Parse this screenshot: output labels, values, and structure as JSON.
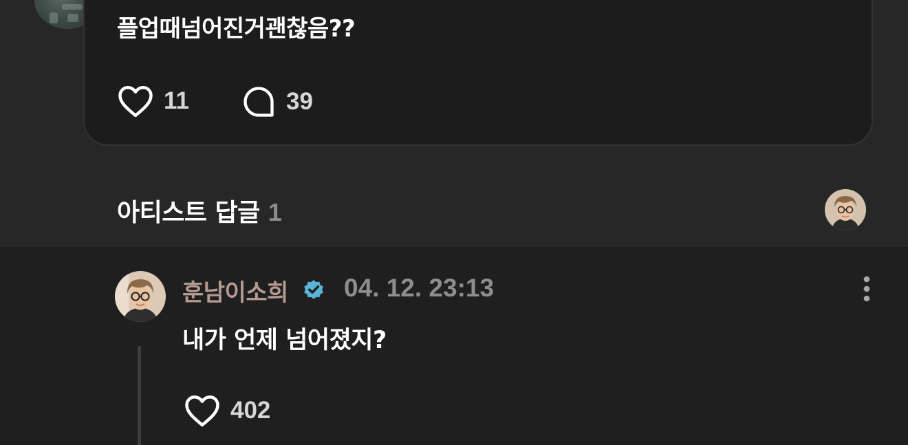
{
  "post": {
    "text": "플업때넘어진거괜찮음??",
    "likes": "11",
    "comments": "39"
  },
  "artist_replies": {
    "title": "아티스트 답글",
    "count": "1"
  },
  "reply": {
    "author": "훈남이소희",
    "timestamp": "04. 12. 23:13",
    "text": "내가 언제 넘어졌지?",
    "likes": "402"
  },
  "icons": {
    "like": "heart-outline-icon",
    "comment": "speech-bubble-icon",
    "verified": "verified-check-badge-icon",
    "more": "vertical-ellipsis-icon"
  },
  "colors": {
    "background": "#272727",
    "card": "#1c1c1c",
    "reply_background": "#1f1f1f",
    "author_name": "#b59a93",
    "verified_badge": "#5ab4d8",
    "muted_text": "#8e8e8e"
  }
}
